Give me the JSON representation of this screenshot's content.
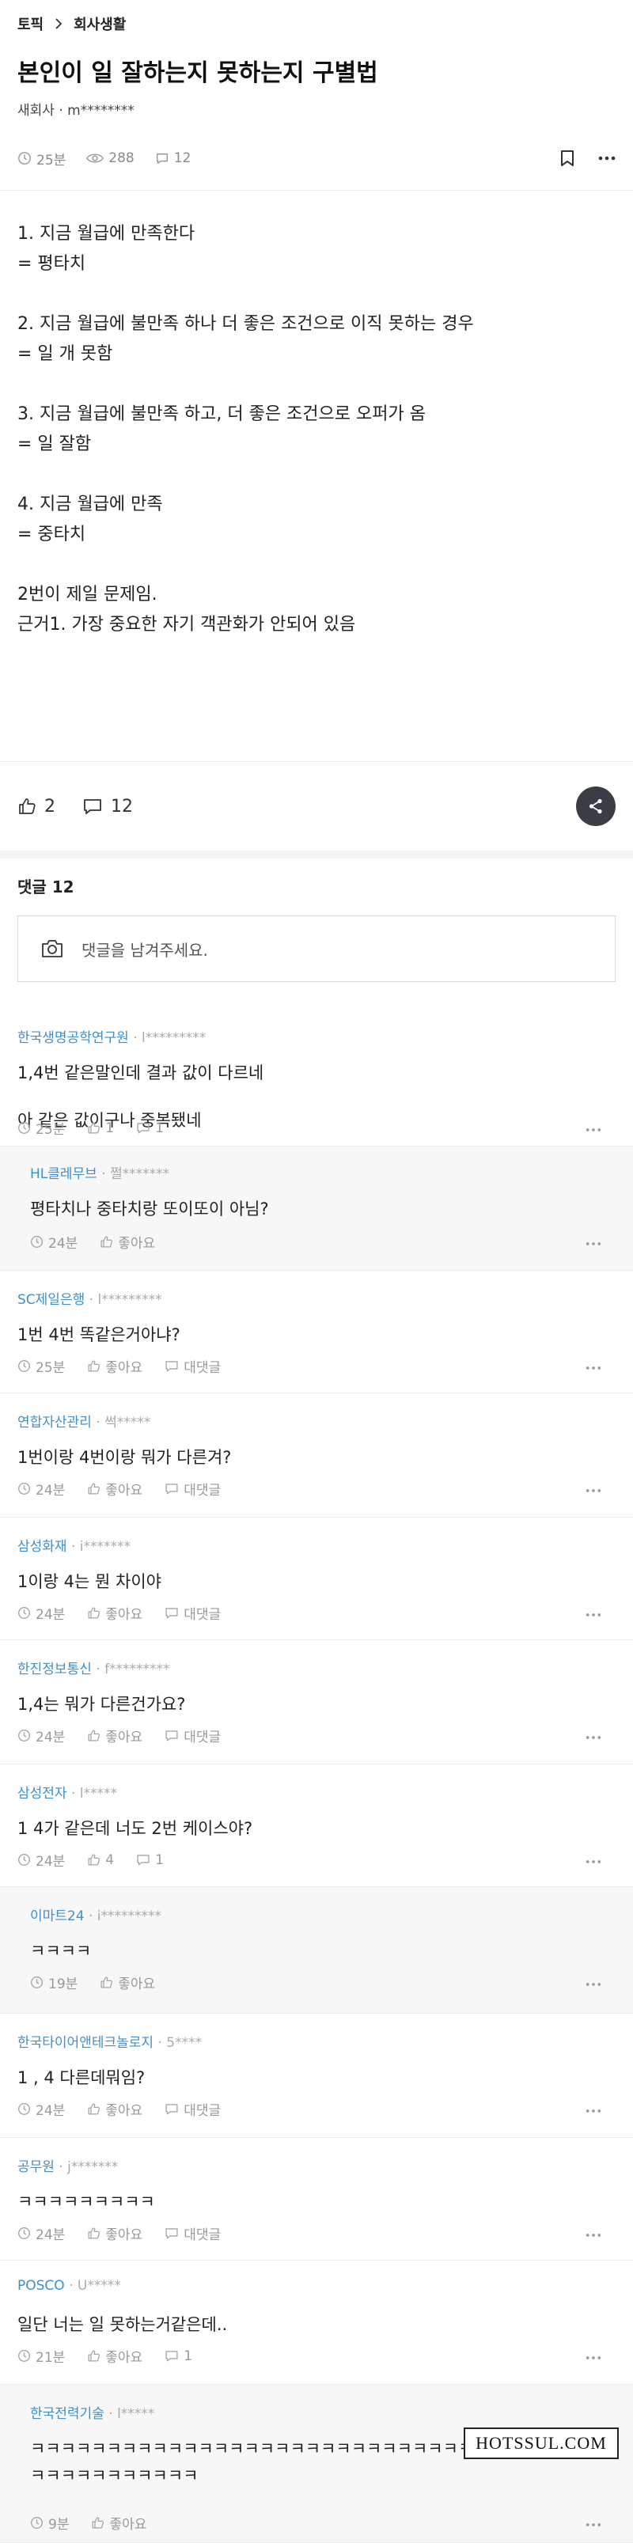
{
  "breadcrumb": {
    "section": "토픽",
    "board": "회사생활"
  },
  "post": {
    "title": "본인이 일 잘하는지 못하는지 구별법",
    "author_company": "새회사",
    "author_id": "m********",
    "time": "25분",
    "views": "288",
    "comment_count": "12",
    "body_lines": [
      "1. 지금 월급에 만족한다",
      "= 평타치",
      "",
      "2. 지금 월급에 불만족 하나 더 좋은 조건으로 이직 못하는 경우",
      "= 일 개 못함",
      "",
      "3. 지금 월급에 불만족 하고, 더 좋은 조건으로 오퍼가 옴",
      "= 일 잘함",
      "",
      "4. 지금 월급에 만족",
      "= 중타치",
      "",
      "2번이 제일 문제임.",
      "근거1. 가장 중요한 자기 객관화가 안되어 있음"
    ],
    "likes": "2",
    "comments": "12"
  },
  "comments_section": {
    "header": "댓글 12",
    "placeholder": "댓글을 남겨주세요."
  },
  "comments": [
    {
      "company": "한국생명공학연구원",
      "user": "l*********",
      "lines": [
        "1,4번 같은말인데 결과 값이 다르네",
        "아 같은 값이구나 중복됐네"
      ],
      "time": "25분",
      "like": "1",
      "reply": "1",
      "is_reply": false
    },
    {
      "company": "HL클레무브",
      "user": "쩔*******",
      "lines": [
        "평타치나 중타치랑 또이또이 아님?"
      ],
      "time": "24분",
      "like": "좋아요",
      "reply": "",
      "is_reply": true
    },
    {
      "company": "SC제일은행",
      "user": "l*********",
      "lines": [
        "1번 4번 똑같은거아냐?"
      ],
      "time": "25분",
      "like": "좋아요",
      "reply": "대댓글",
      "is_reply": false
    },
    {
      "company": "연합자산관리",
      "user": "썩*****",
      "lines": [
        "1번이랑 4번이랑 뭐가 다른겨?"
      ],
      "time": "24분",
      "like": "좋아요",
      "reply": "대댓글",
      "is_reply": false
    },
    {
      "company": "삼성화재",
      "user": "i*******",
      "lines": [
        "1이랑 4는 뭔 차이야"
      ],
      "time": "24분",
      "like": "좋아요",
      "reply": "대댓글",
      "is_reply": false
    },
    {
      "company": "한진정보통신",
      "user": "f*********",
      "lines": [
        "1,4는 뭐가 다른건가요?"
      ],
      "time": "24분",
      "like": "좋아요",
      "reply": "대댓글",
      "is_reply": false
    },
    {
      "company": "삼성전자",
      "user": "l*****",
      "lines": [
        "1 4가 같은데 너도 2번 케이스야?"
      ],
      "time": "24분",
      "like": "4",
      "reply": "1",
      "is_reply": false
    },
    {
      "company": "이마트24",
      "user": "i*********",
      "lines": [
        "ㅋㅋㅋㅋ"
      ],
      "time": "19분",
      "like": "좋아요",
      "reply": "",
      "is_reply": true
    },
    {
      "company": "한국타이어앤테크놀로지",
      "user": "5****",
      "lines": [
        "1 , 4 다른데뭐임?"
      ],
      "time": "24분",
      "like": "좋아요",
      "reply": "대댓글",
      "is_reply": false
    },
    {
      "company": "공무원",
      "user": "j*******",
      "lines": [
        "ㅋㅋㅋㅋㅋㅋㅋㅋㅋ"
      ],
      "time": "24분",
      "like": "좋아요",
      "reply": "대댓글",
      "is_reply": false
    },
    {
      "company": "POSCO",
      "user": "U*****",
      "lines": [
        "일단 너는 일 못하는거같은데.."
      ],
      "time": "21분",
      "like": "좋아요",
      "reply": "1",
      "is_reply": false
    },
    {
      "company": "한국전력기술",
      "user": "l*****",
      "lines": [
        "ㅋㅋㅋㅋㅋㅋㅋㅋㅋㅋㅋㅋㅋㅋㅋㅋㅋㅋㅋㅋㅋㅋㅋㅋㅋㅋㅋㅋㅋㅋㅋㅋㅋㅋㅋㅋㅋㅋㅋㅋㅋㅋㅋㅋㅋㅋㅋㅋ"
      ],
      "time": "9분",
      "like": "좋아요",
      "reply": "",
      "is_reply": true
    }
  ],
  "watermark": "HOTSSUL.COM",
  "colors": {
    "company": "#3f8fcc",
    "reply_bg": "#f7f7f8",
    "share_bg": "#3b3d45"
  }
}
